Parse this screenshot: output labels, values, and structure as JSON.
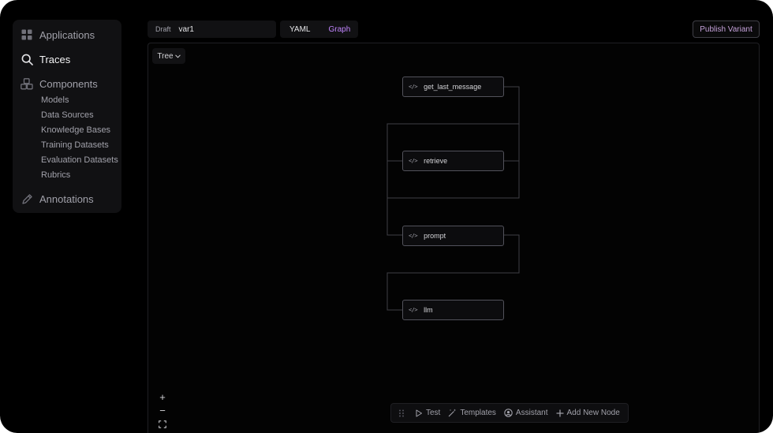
{
  "sidebar": {
    "applications_label": "Applications",
    "traces_label": "Traces",
    "components_label": "Components",
    "annotations_label": "Annotations",
    "components_items": [
      {
        "label": "Models"
      },
      {
        "label": "Data Sources"
      },
      {
        "label": "Knowledge Bases"
      },
      {
        "label": "Training Datasets"
      },
      {
        "label": "Evaluation Datasets"
      },
      {
        "label": "Rubrics"
      }
    ]
  },
  "topbar": {
    "draft_label": "Draft",
    "variant_name": "var1",
    "view_tabs": [
      {
        "label": "YAML",
        "active": false
      },
      {
        "label": "Graph",
        "active": true
      }
    ],
    "publish_label": "Publish Variant"
  },
  "canvas": {
    "layout_selector": "Tree",
    "nodes": [
      {
        "label": "get_last_message",
        "icon": "code-icon"
      },
      {
        "label": "retrieve",
        "icon": "code-icon"
      },
      {
        "label": "prompt",
        "icon": "code-icon"
      },
      {
        "label": "llm",
        "icon": "code-icon"
      }
    ],
    "zoom_controls": [
      "+",
      "−",
      "⛶"
    ]
  },
  "toolbar": {
    "test_label": "Test",
    "templates_label": "Templates",
    "assistant_label": "Assistant",
    "add_node_label": "Add New Node"
  },
  "colors": {
    "background": "#000000",
    "panel": "#111113",
    "accent": "#c084fc",
    "node_border": "#52525b",
    "edge": "#3f3f46"
  }
}
